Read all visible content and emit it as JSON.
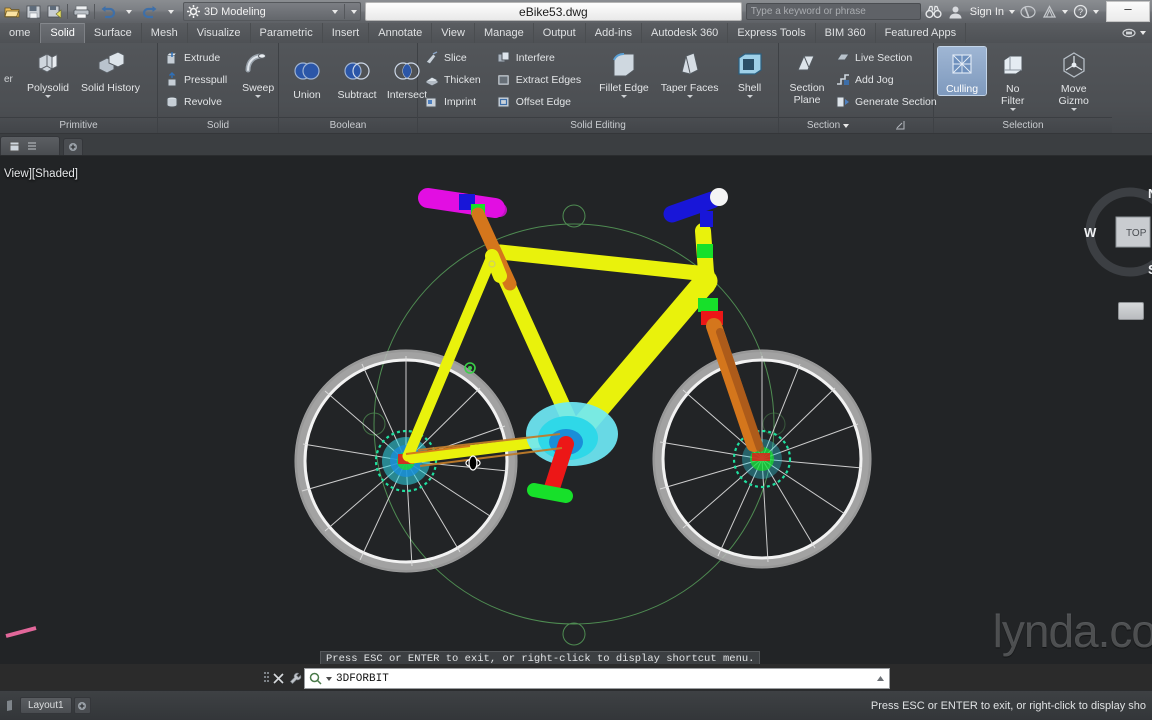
{
  "app": {
    "document_title": "eBike53.dwg",
    "workspace": "3D Modeling",
    "search_placeholder": "Type a keyword or phrase",
    "sign_in": "Sign In",
    "minimize": "–"
  },
  "quick_access": [
    {
      "name": "open-icon",
      "title": "Open"
    },
    {
      "name": "save-icon",
      "title": "Save"
    },
    {
      "name": "save-as-icon",
      "title": "Save As"
    },
    {
      "name": "plot-icon",
      "title": "Plot"
    },
    {
      "name": "undo-icon",
      "title": "Undo"
    },
    {
      "name": "redo-icon",
      "title": "Redo"
    }
  ],
  "ribbon": {
    "tabs": [
      {
        "label": "ome",
        "active": false
      },
      {
        "label": "Solid",
        "active": true
      },
      {
        "label": "Surface",
        "active": false
      },
      {
        "label": "Mesh",
        "active": false
      },
      {
        "label": "Visualize",
        "active": false
      },
      {
        "label": "Parametric",
        "active": false
      },
      {
        "label": "Insert",
        "active": false
      },
      {
        "label": "Annotate",
        "active": false
      },
      {
        "label": "View",
        "active": false
      },
      {
        "label": "Manage",
        "active": false
      },
      {
        "label": "Output",
        "active": false
      },
      {
        "label": "Add-ins",
        "active": false
      },
      {
        "label": "Autodesk 360",
        "active": false
      },
      {
        "label": "Express Tools",
        "active": false
      },
      {
        "label": "BIM 360",
        "active": false
      },
      {
        "label": "Featured Apps",
        "active": false
      }
    ],
    "panels": {
      "primitive": {
        "title": "Primitive",
        "buttons": [
          {
            "label": "Polysolid",
            "icon": "polysolid-icon",
            "dropdown": true
          },
          {
            "label": "Solid History",
            "icon": "solid-history-icon",
            "dropdown": false
          }
        ],
        "partial_left_label": "er"
      },
      "solid": {
        "title": "Solid",
        "small_buttons": [
          {
            "label": "Extrude",
            "icon": "extrude-icon"
          },
          {
            "label": "Presspull",
            "icon": "presspull-icon"
          },
          {
            "label": "Revolve",
            "icon": "revolve-icon"
          }
        ],
        "big_buttons": [
          {
            "label": "Sweep",
            "icon": "sweep-icon",
            "dropdown": true
          }
        ]
      },
      "boolean": {
        "title": "Boolean",
        "buttons": [
          {
            "label": "Union",
            "icon": "union-icon"
          },
          {
            "label": "Subtract",
            "icon": "subtract-icon"
          },
          {
            "label": "Intersect",
            "icon": "intersect-icon"
          }
        ]
      },
      "solid_editing": {
        "title": "Solid Editing",
        "small_col_1": [
          {
            "label": "Slice",
            "icon": "slice-icon"
          },
          {
            "label": "Thicken",
            "icon": "thicken-icon"
          },
          {
            "label": "Imprint",
            "icon": "imprint-icon"
          }
        ],
        "small_col_2": [
          {
            "label": "Interfere",
            "icon": "interfere-icon"
          },
          {
            "label": "Extract Edges",
            "icon": "extract-edges-icon"
          },
          {
            "label": "Offset Edge",
            "icon": "offset-edge-icon"
          }
        ],
        "big_buttons": [
          {
            "label": "Fillet Edge",
            "icon": "fillet-edge-icon",
            "dropdown": true
          },
          {
            "label": "Taper Faces",
            "icon": "taper-faces-icon",
            "dropdown": true
          },
          {
            "label": "Shell",
            "icon": "shell-icon",
            "dropdown": true
          }
        ]
      },
      "section": {
        "title": "Section",
        "big_buttons": [
          {
            "label": "Section Plane",
            "icon": "section-plane-icon"
          }
        ],
        "small_buttons": [
          {
            "label": "Live Section",
            "icon": "live-section-icon"
          },
          {
            "label": "Add Jog",
            "icon": "add-jog-icon"
          },
          {
            "label": "Generate Section",
            "icon": "generate-section-icon"
          }
        ]
      },
      "selection": {
        "title": "Selection",
        "buttons": [
          {
            "label": "Culling",
            "icon": "culling-icon",
            "active": true,
            "dropdown": false
          },
          {
            "label": "No Filter",
            "icon": "no-filter-icon",
            "active": false,
            "dropdown": true
          },
          {
            "label": "Move Gizmo",
            "icon": "move-gizmo-icon",
            "active": false,
            "dropdown": true
          }
        ]
      }
    }
  },
  "file_tab": {
    "label": ""
  },
  "viewport": {
    "label": "View][Shaded]",
    "prompt_text": "Press ESC or ENTER to exit, or right-click to display shortcut menu.",
    "watermark": "lynda.co",
    "viewcube": {
      "north": "N",
      "west": "W",
      "south": "S",
      "top_face": "TOP"
    },
    "background_color": "#222426"
  },
  "command_line": {
    "command": "3DFORBIT",
    "close_label": "✕",
    "search_icon": "command-search-icon"
  },
  "status_bar": {
    "layout_tab": "Layout1",
    "add_layout": "+",
    "message": "Press ESC or ENTER to exit, or right-click to display sho"
  },
  "colors": {
    "frame_yellow": "#e9f20c",
    "grip_magenta": "#e20ee2",
    "grip_blue": "#1816d8",
    "fork_orange": "#d4761c",
    "hub_cyan": "#2fd8e8",
    "crank_red": "#ec1717",
    "accent_green": "#17e02a",
    "orbit_green": "#4f8c52",
    "wheel_white": "#e8e8e8"
  }
}
